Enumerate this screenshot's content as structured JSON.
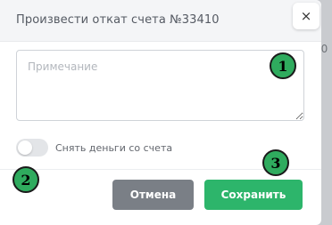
{
  "modal": {
    "title": "Произвести откат счета №33410",
    "close_label": "×",
    "note_placeholder": "Примечание",
    "note_value": "",
    "toggle": {
      "label": "Снять деньги со счета",
      "checked": false
    },
    "buttons": {
      "cancel_label": "Отмена",
      "save_label": "Сохранить"
    }
  },
  "background": {
    "partial_text": "00"
  },
  "markers": [
    "1",
    "2",
    "3"
  ],
  "colors": {
    "save": "#2db56b",
    "cancel": "#7a7f86",
    "marker": "#2fab5e"
  }
}
